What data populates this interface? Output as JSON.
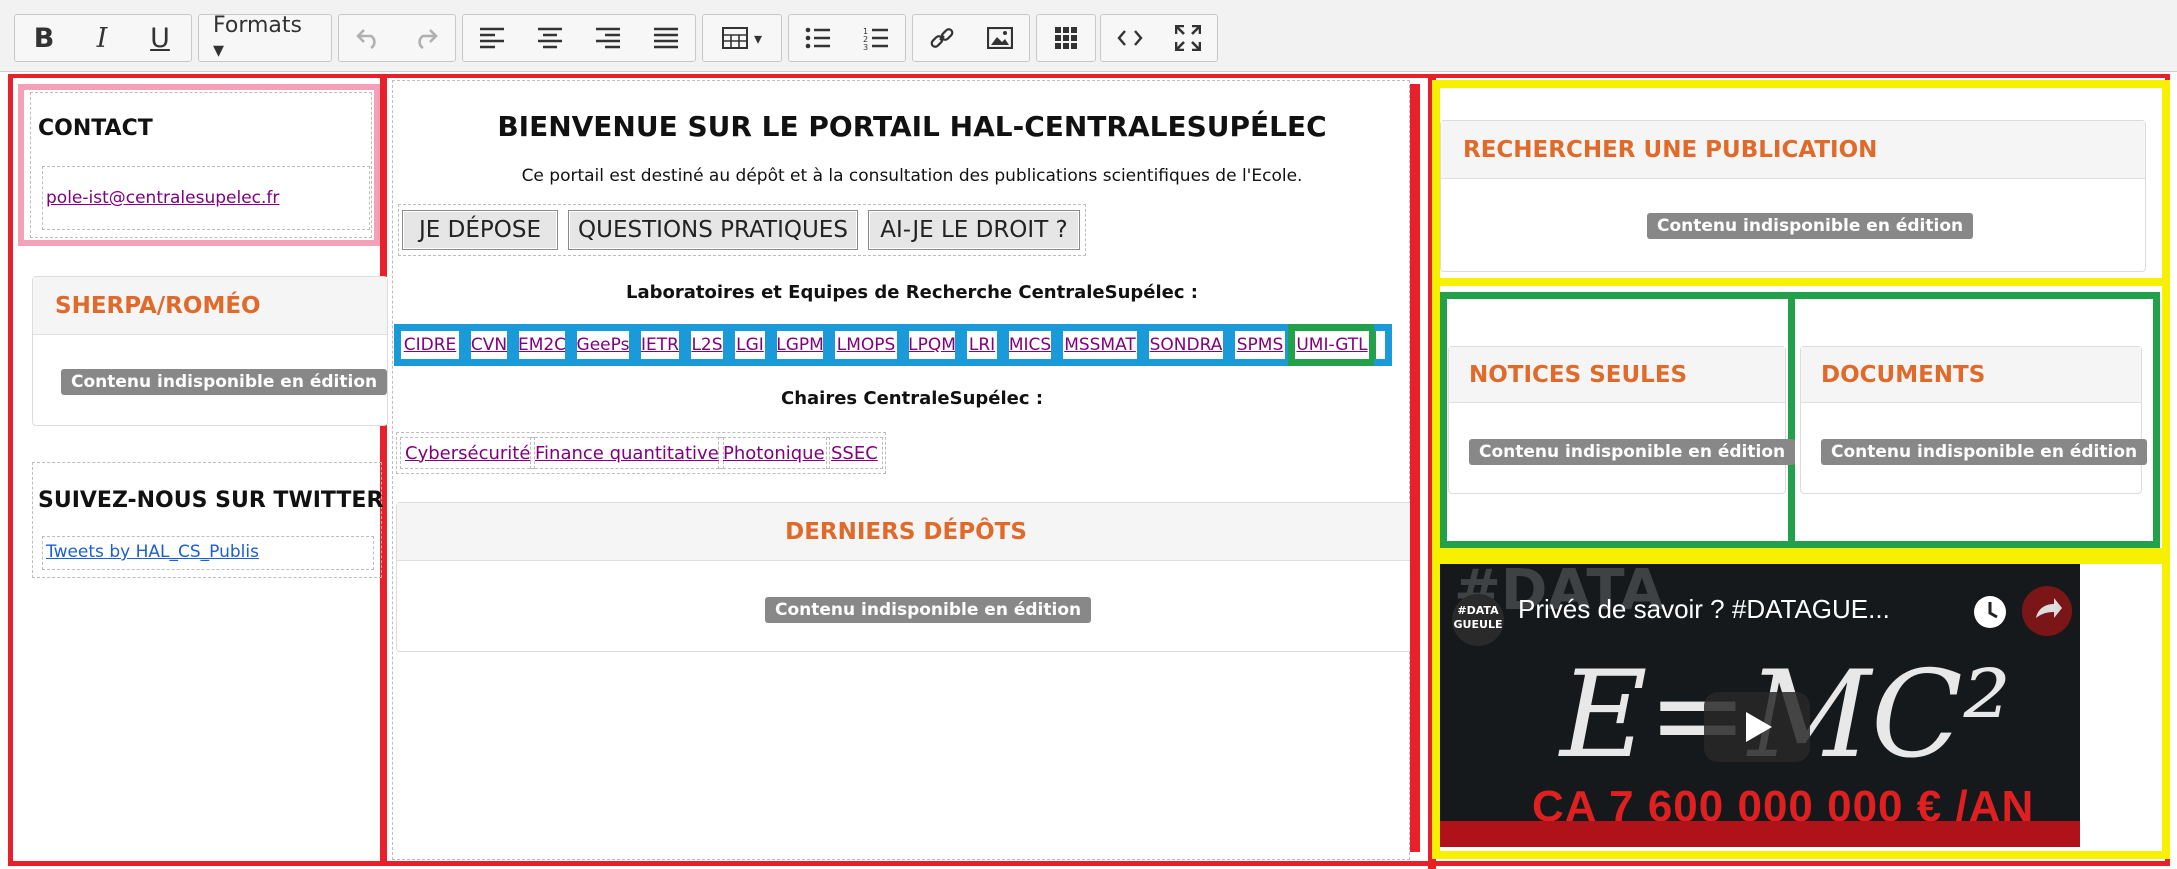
{
  "toolbar": {
    "bold": "B",
    "italic": "I",
    "underline": "U",
    "formats": "Formats ▾",
    "dropdown_caret": "▾"
  },
  "left": {
    "contact_title": "CONTACT",
    "contact_email": "pole-ist@centralesupelec.fr",
    "sherpa_title": "SHERPA/ROMÉO",
    "sherpa_badge": "Contenu indisponible en édition",
    "twitter_title": "SUIVEZ-NOUS SUR TWITTER",
    "twitter_link": "Tweets by HAL_CS_Publis"
  },
  "center": {
    "welcome_title": "BIENVENUE SUR LE PORTAIL HAL-CENTRALESUPÉLEC",
    "intro": "Ce portail est destiné au dépôt et à la consultation des publications scientifiques de l'Ecole.",
    "buttons": [
      "JE DÉPOSE",
      "QUESTIONS PRATIQUES",
      "AI-JE LE DROIT ?"
    ],
    "labs_title": "Laboratoires et Equipes de Recherche CentraleSupélec :",
    "labs": [
      "CIDRE",
      "CVN",
      "EM2C",
      "GeePs",
      "IETR",
      "L2S",
      "LGI",
      "LGPM",
      "LMOPS",
      "LPQM",
      "LRI",
      "MICS",
      "MSSMAT",
      "SONDRA",
      "SPMS",
      "UMI-GTL"
    ],
    "chairs_title": "Chaires CentraleSupélec :",
    "chairs": [
      "Cybersécurité",
      "Finance quantitative",
      "Photonique",
      "SSEC"
    ],
    "deposits_title": "DERNIERS DÉPÔTS",
    "deposits_badge": "Contenu indisponible en édition"
  },
  "right": {
    "search_title": "RECHERCHER UNE PUBLICATION",
    "search_badge": "Contenu indisponible en édition",
    "notices_title": "NOTICES SEULES",
    "notices_badge": "Contenu indisponible en édition",
    "documents_title": "DOCUMENTS",
    "documents_badge": "Contenu indisponible en édition",
    "video": {
      "title": "Privés de savoir ? #DATAGUE...",
      "channel_logo": "#DATA GUEULE",
      "big_text": "E=MC²",
      "overlay_text": "CA 7 600 000 000 € /AN",
      "watermark": "#DATA"
    }
  },
  "colors": {
    "frame_red": "#e8202a",
    "frame_pink": "#f4a0b8",
    "frame_yellow": "#f7f000",
    "frame_green": "#22a04a",
    "lab_blue": "#1a9ad8",
    "title_orange": "#e06a2a",
    "badge_gray": "#888888"
  }
}
